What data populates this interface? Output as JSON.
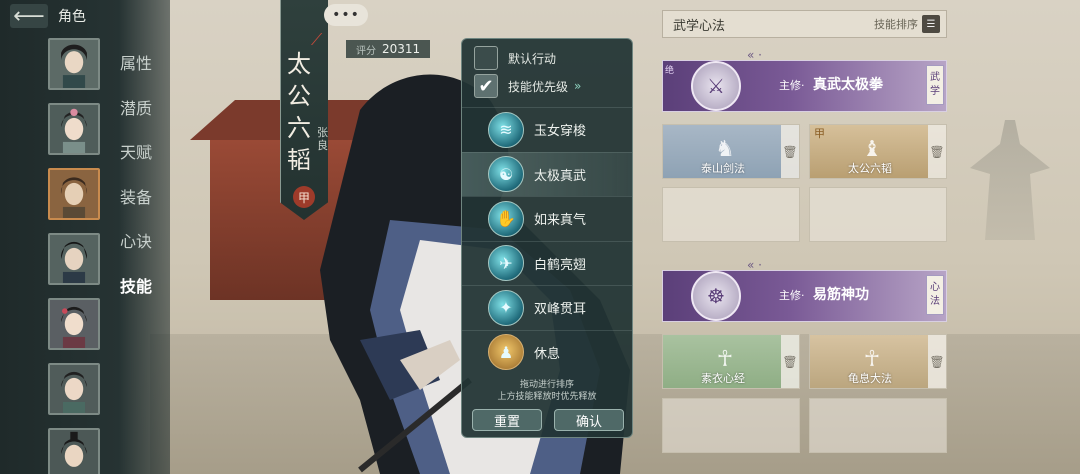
{
  "topbar": {
    "back_icon": "arrow-left-icon",
    "title": "角色"
  },
  "tabs": [
    "属性",
    "潜质",
    "天赋",
    "装备",
    "心诀",
    "技能"
  ],
  "active_tab": "技能",
  "banner": {
    "name": "太公六韬",
    "sub": "张良",
    "grade": "甲"
  },
  "more_label": "•••",
  "score": {
    "label": "评分",
    "value": "20311"
  },
  "popup": {
    "default_action": "默认行动",
    "skill_priority": "技能优先级",
    "skill_priority_chevron": "»",
    "skills": [
      {
        "name": "玉女穿梭",
        "icon": "sword-swirl-icon"
      },
      {
        "name": "太极真武",
        "icon": "taiji-icon"
      },
      {
        "name": "如来真气",
        "icon": "palm-qi-icon"
      },
      {
        "name": "白鹤亮翅",
        "icon": "crane-icon"
      },
      {
        "name": "双峰贯耳",
        "icon": "twin-peak-icon"
      },
      {
        "name": "休息",
        "icon": "meditate-icon"
      }
    ],
    "hint_line1": "拖动进行排序",
    "hint_line2": "上方技能释放时优先释放",
    "reset": "重置",
    "confirm": "确认"
  },
  "right_panel": {
    "title": "武学心法",
    "sort_label": "技能排序",
    "sort_icon": "list-sort-icon",
    "martial": {
      "prefix": "主修·",
      "name": "真武太极拳",
      "tag": "武学",
      "corner": "绝",
      "slots": [
        {
          "name": "泰山剑法",
          "grade": ""
        },
        {
          "name": "太公六韬",
          "grade": "甲"
        }
      ]
    },
    "mind": {
      "prefix": "主修·",
      "name": "易筋神功",
      "tag": "心法",
      "slots": [
        {
          "name": "素衣心经"
        },
        {
          "name": "龟息大法"
        }
      ]
    }
  }
}
